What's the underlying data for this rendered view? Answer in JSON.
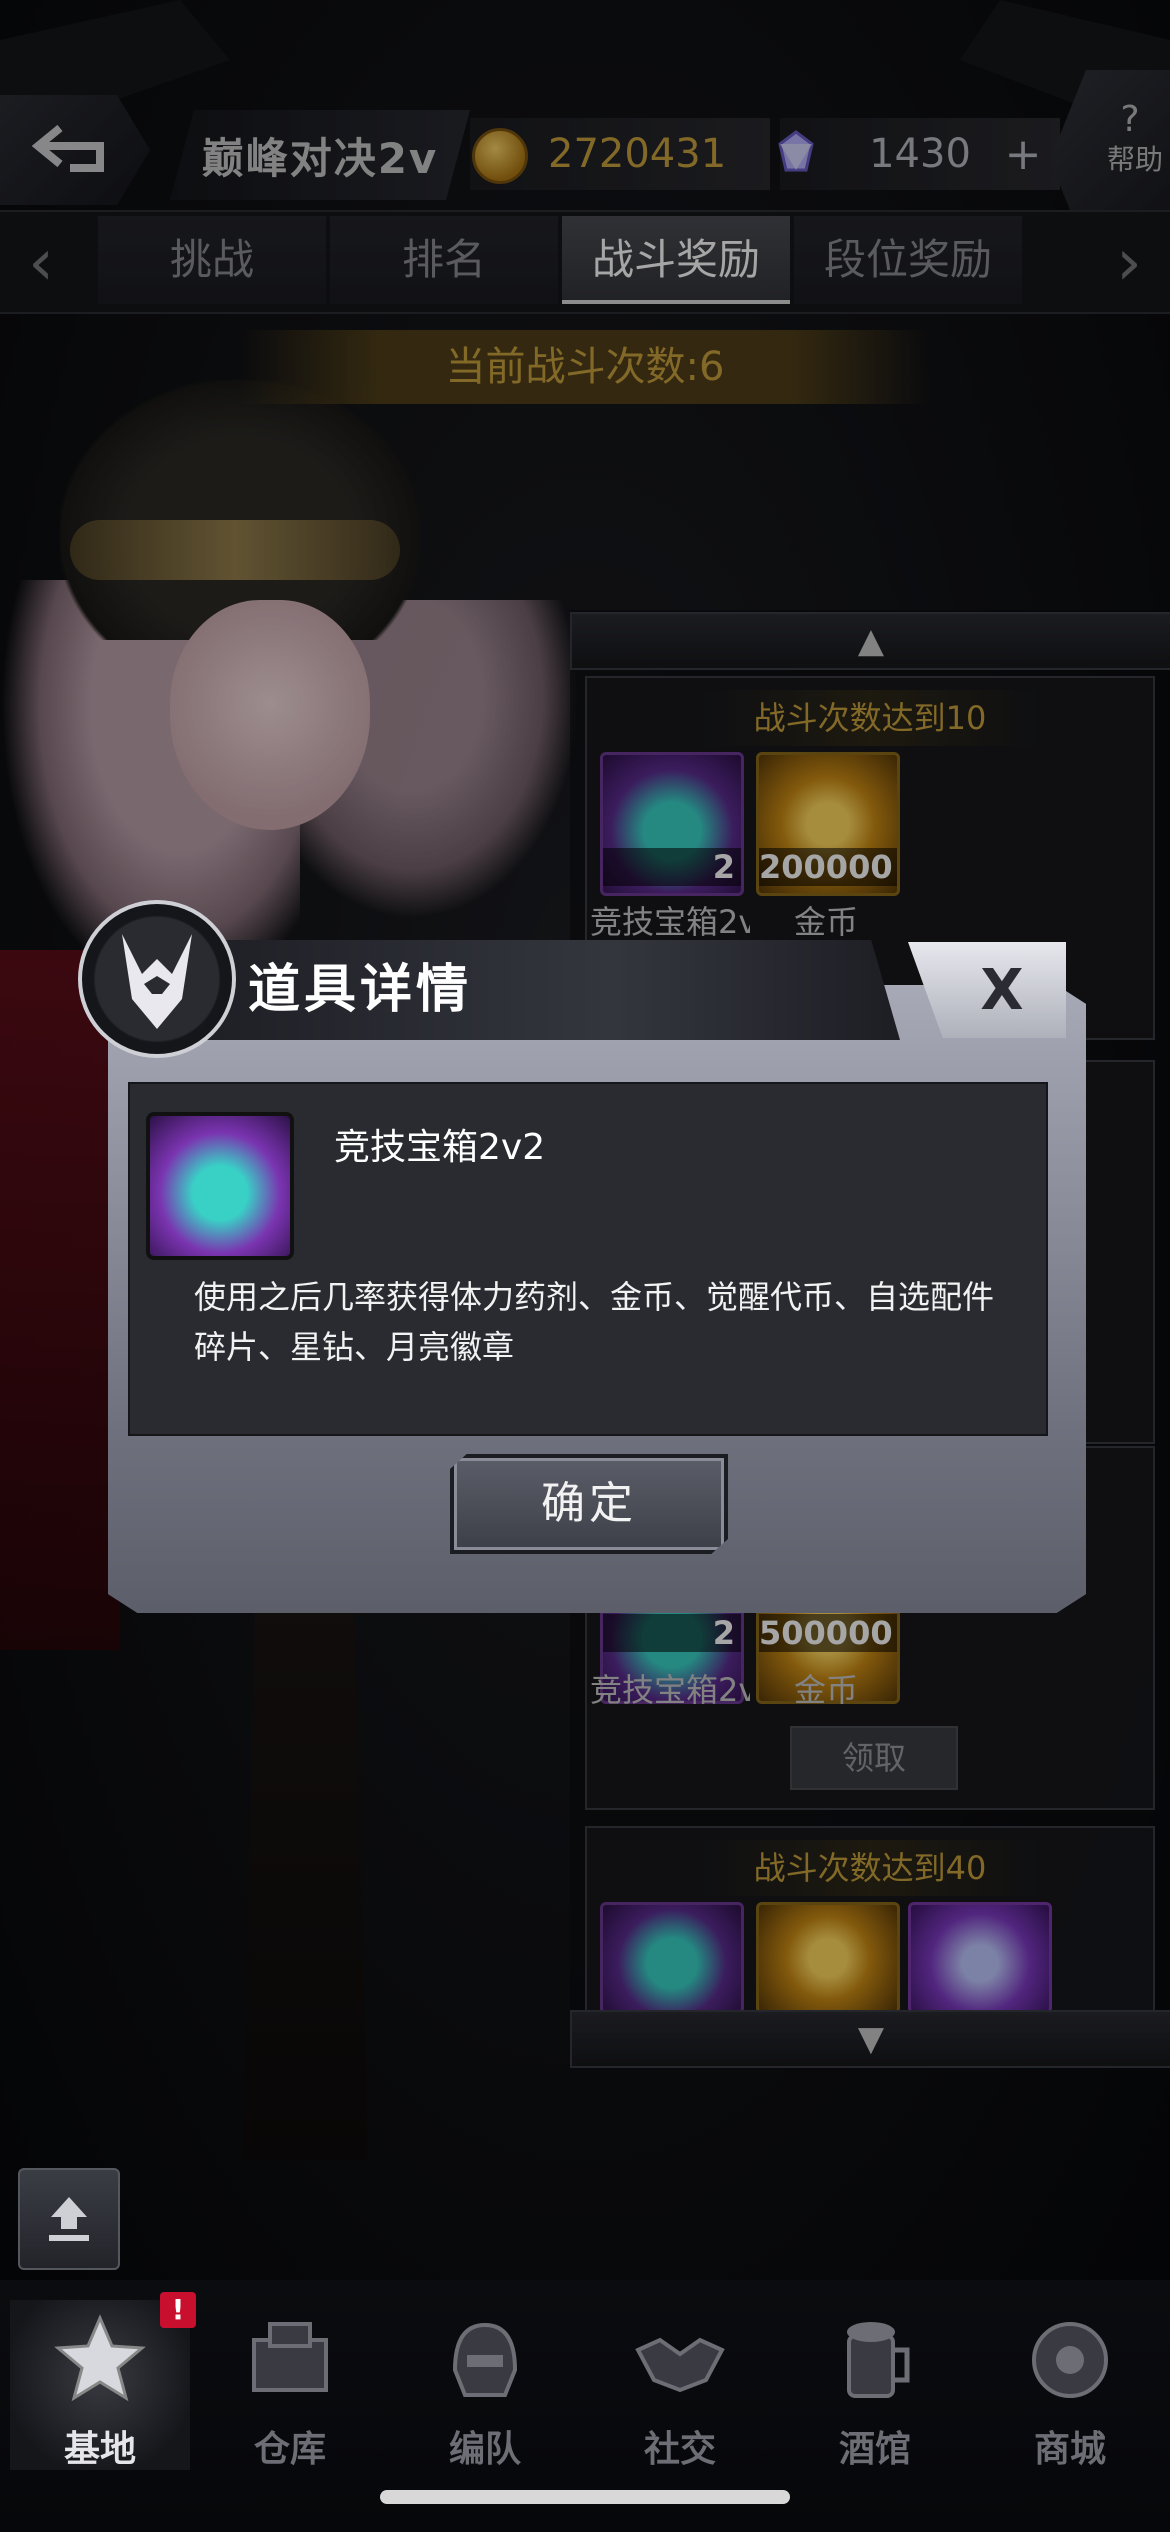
{
  "header": {
    "title": "巅峰对决2v",
    "coins": "2720431",
    "gems": "1430",
    "plus": "+",
    "help_icon": "?",
    "help_label": "帮助",
    "back_icon": "back-arrow-icon"
  },
  "tabs": [
    {
      "label": "挑战"
    },
    {
      "label": "排名"
    },
    {
      "label": "战斗奖励"
    },
    {
      "label": "段位奖励"
    }
  ],
  "tab_nav": {
    "left": "‹",
    "right": "›"
  },
  "battle_count": "当前战斗次数:6",
  "reward_list": {
    "up": "▲",
    "down": "▼",
    "cards": [
      {
        "title": "战斗次数达到10",
        "items": [
          {
            "icon": "gift-box-icon",
            "qty": "2",
            "name": "竞技宝箱2v"
          },
          {
            "icon": "gold-coin-icon",
            "qty": "200000",
            "name": "金币"
          }
        ]
      },
      {
        "title": "",
        "items": [
          {
            "icon": "gift-box-icon",
            "qty": "2",
            "name": "竞技宝箱2v"
          },
          {
            "icon": "gold-coin-icon",
            "qty": "500000",
            "name": "金币"
          }
        ],
        "claim": "领取"
      },
      {
        "title": "战斗次数达到40",
        "items": [
          {
            "icon": "gift-box-icon"
          },
          {
            "icon": "gold-coin-icon"
          },
          {
            "icon": "gem-icon"
          }
        ]
      }
    ]
  },
  "modal": {
    "title": "道具详情",
    "close": "X",
    "item_name": "竞技宝箱2v2",
    "description": "使用之后几率获得体力药剂、金币、觉醒代币、自选配件碎片、星钻、月亮徽章",
    "confirm": "确定"
  },
  "nav": {
    "badge": "!",
    "items": [
      {
        "label": "基地",
        "icon": "base-icon"
      },
      {
        "label": "仓库",
        "icon": "warehouse-icon"
      },
      {
        "label": "编队",
        "icon": "squad-icon"
      },
      {
        "label": "社交",
        "icon": "handshake-icon"
      },
      {
        "label": "酒馆",
        "icon": "tavern-icon"
      },
      {
        "label": "商城",
        "icon": "shop-icon"
      }
    ]
  },
  "colors": {
    "accent_gold": "#c9a23e",
    "modal_bg": "#a7a9b6",
    "badge_red": "#c8102e"
  }
}
